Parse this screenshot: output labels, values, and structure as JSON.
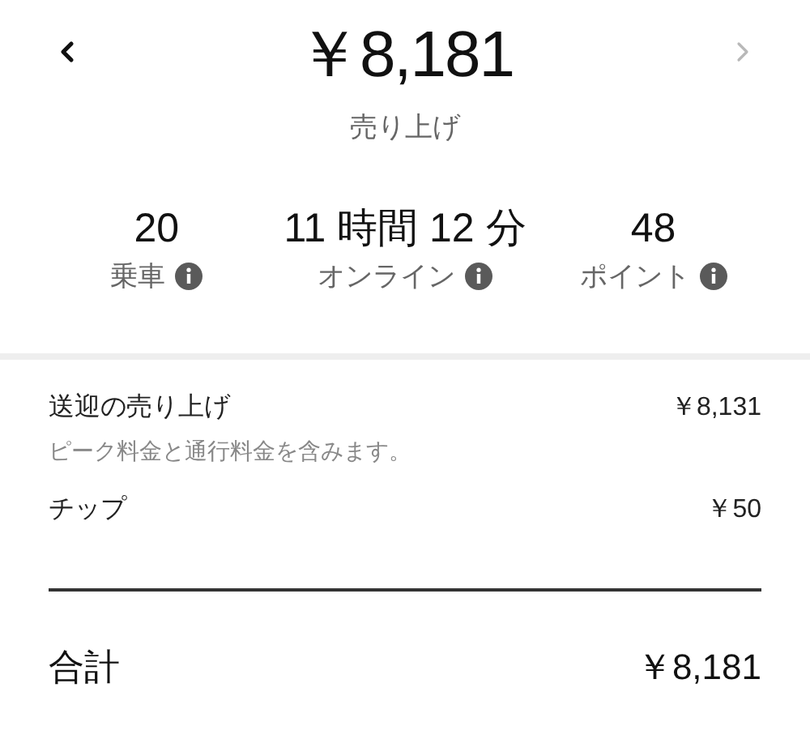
{
  "header": {
    "amount": "￥8,181",
    "label": "売り上げ",
    "nav": [
      {
        "kind": "prev",
        "disabled": false
      },
      {
        "kind": "next",
        "disabled": true
      }
    ]
  },
  "stats": [
    {
      "value": "20",
      "label": "乗車"
    },
    {
      "value": "11 時間 12 分",
      "label": "オンライン"
    },
    {
      "value": "48",
      "label": "ポイント"
    }
  ],
  "breakdown": [
    {
      "label": "送迎の売り上げ",
      "amount": "￥8,131",
      "note": "ピーク料金と通行料金を含みます。"
    },
    {
      "label": "チップ",
      "amount": "￥50"
    }
  ],
  "total": {
    "label": "合計",
    "amount": "￥8,181"
  }
}
